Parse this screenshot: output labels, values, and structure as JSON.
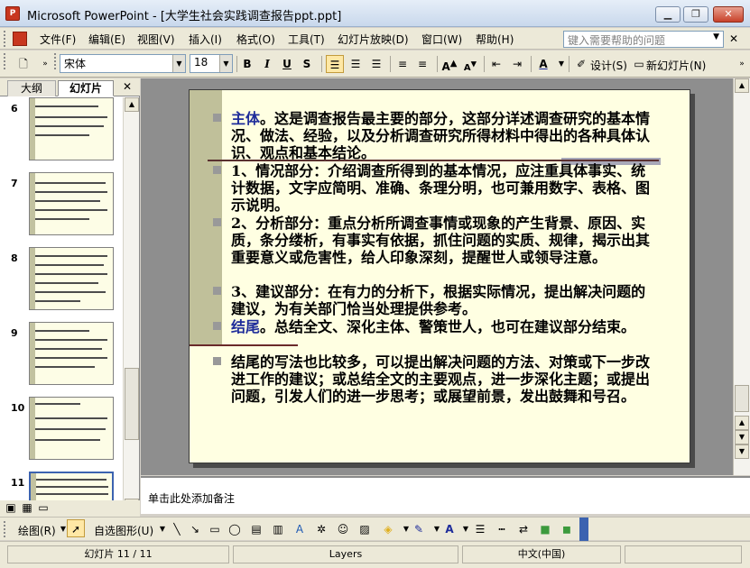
{
  "window": {
    "title": "Microsoft PowerPoint - [大学生社会实践调查报告ppt.ppt]",
    "app_icon_label": "P"
  },
  "menu": {
    "items": [
      "文件(F)",
      "编辑(E)",
      "视图(V)",
      "插入(I)",
      "格式(O)",
      "工具(T)",
      "幻灯片放映(D)",
      "窗口(W)",
      "帮助(H)"
    ],
    "help_placeholder": "键入需要帮助的问题"
  },
  "format_toolbar": {
    "font_name": "宋体",
    "font_size": "18",
    "bold": "B",
    "italic": "I",
    "underline": "U",
    "shadow": "S",
    "design_label": "设计(S)",
    "new_slide_label": "新幻灯片(N)"
  },
  "left_pane": {
    "tabs": [
      "大纲",
      "幻灯片"
    ],
    "thumbnails": [
      {
        "number": "6"
      },
      {
        "number": "7"
      },
      {
        "number": "8"
      },
      {
        "number": "9"
      },
      {
        "number": "10"
      },
      {
        "number": "11",
        "selected": true
      }
    ]
  },
  "slide": {
    "paragraphs": [
      {
        "keyword": "主体",
        "text": "。这是调查报告最主要的部分，这部分详述调查研究的基本情况、做法、经验，以及分析调查研究所得材料中得出的各种具体认识、观点和基本结论。"
      },
      {
        "keyword": "",
        "text": "1、情况部分：介绍调查所得到的基本情况，应注重具体事实、统计数据，文字应简明、准确、条理分明，也可兼用数字、表格、图示说明。"
      },
      {
        "keyword": "",
        "text": " 2、分析部分：重点分析所调查事情或现象的产生背景、原因、实质，条分缕析，有事实有依据，抓住问题的实质、规律，揭示出其重要意义或危害性，给人印象深刻，提醒世人或领导注意。"
      },
      {
        "keyword": "",
        "text": "3、建议部分：在有力的分析下，根据实际情况，提出解决问题的建议，为有关部门恰当处理提供参考。"
      },
      {
        "keyword": "结尾",
        "text": "。总结全文、深化主体、警策世人，也可在建议部分结束。"
      },
      {
        "keyword": "",
        "text": "结尾的写法也比较多，可以提出解决问题的方法、对策或下一步改进工作的建议；或总结全文的主要观点，进一步深化主题；或提出问题，引发人们的进一步思考；或展望前景，发出鼓舞和号召。"
      }
    ]
  },
  "notes": {
    "placeholder": "单击此处添加备注"
  },
  "draw_toolbar": {
    "draw_label": "绘图(R)",
    "autoshape_label": "自选图形(U)"
  },
  "status": {
    "slide_info": "幻灯片 11 / 11",
    "design": "Layers",
    "language": "中文(中国)"
  },
  "colors": {
    "slide_bg": "#ffffe2",
    "keyword": "#1e2c9a",
    "band": "#c0c09a"
  }
}
